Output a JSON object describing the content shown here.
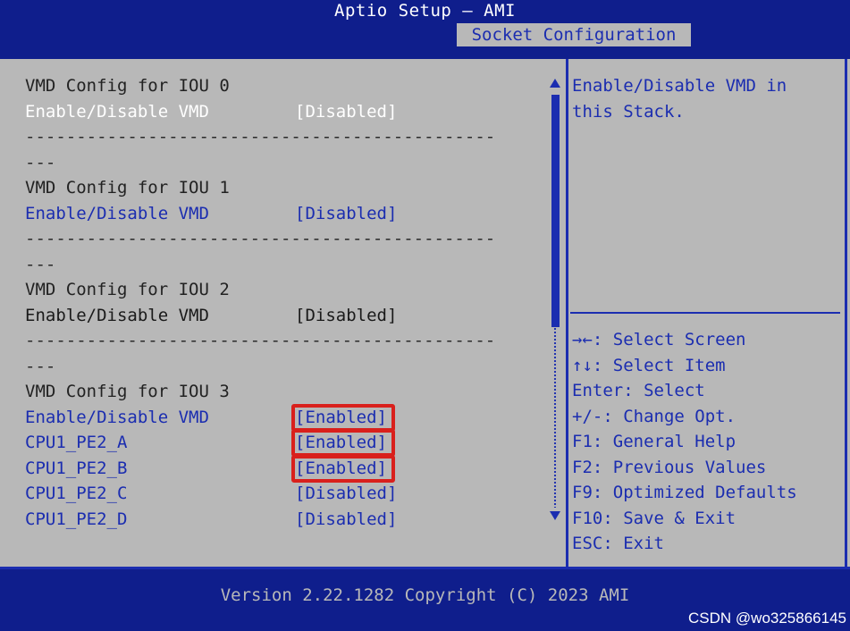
{
  "app": {
    "title": "Aptio Setup – AMI",
    "tab": "Socket Configuration"
  },
  "settings": [
    {
      "type": "heading",
      "label": "VMD Config for IOU 0"
    },
    {
      "type": "option",
      "label": "Enable/Disable VMD",
      "value": "[Disabled]",
      "state": "selected"
    },
    {
      "type": "separator",
      "text": "----------------------------------------------"
    },
    {
      "type": "separator",
      "text": "---"
    },
    {
      "type": "heading",
      "label": "VMD Config for IOU 1"
    },
    {
      "type": "option",
      "label": "Enable/Disable VMD",
      "value": "[Disabled]",
      "state": "normal"
    },
    {
      "type": "separator",
      "text": "----------------------------------------------"
    },
    {
      "type": "separator",
      "text": "---"
    },
    {
      "type": "heading",
      "label": "VMD Config for IOU 2"
    },
    {
      "type": "option",
      "label": "Enable/Disable VMD",
      "value": "[Disabled]",
      "state": "readonly"
    },
    {
      "type": "separator",
      "text": "----------------------------------------------"
    },
    {
      "type": "separator",
      "text": "---"
    },
    {
      "type": "heading",
      "label": "VMD Config for IOU 3"
    },
    {
      "type": "option",
      "label": "Enable/Disable VMD",
      "value": "[Enabled]",
      "state": "normal",
      "highlight": true
    },
    {
      "type": "option",
      "label": "CPU1_PE2_A",
      "value": "[Enabled]",
      "state": "normal",
      "highlight": true
    },
    {
      "type": "option",
      "label": "CPU1_PE2_B",
      "value": "[Enabled]",
      "state": "normal",
      "highlight": true
    },
    {
      "type": "option",
      "label": "CPU1_PE2_C",
      "value": "[Disabled]",
      "state": "normal"
    },
    {
      "type": "option",
      "label": "CPU1_PE2_D",
      "value": "[Disabled]",
      "state": "normal"
    }
  ],
  "help": {
    "text_line1": "Enable/Disable VMD in",
    "text_line2": "this Stack."
  },
  "keys": [
    "→←: Select Screen",
    "↑↓: Select Item",
    "Enter: Select",
    "+/-: Change Opt.",
    "F1: General Help",
    "F2: Previous Values",
    "F9: Optimized Defaults",
    "F10: Save & Exit",
    "ESC: Exit"
  ],
  "footer": "Version 2.22.1282 Copyright (C) 2023 AMI",
  "watermark": "CSDN @wo325866145",
  "colors": {
    "background": "#0f1e8c",
    "panel": "#b8b8b8",
    "accent": "#1b2db0",
    "highlight_border": "#d9201c",
    "selected_text": "#ffffff"
  },
  "scrollbar": {
    "up_icon": "triangle-up-icon",
    "down_icon": "triangle-down-icon"
  }
}
